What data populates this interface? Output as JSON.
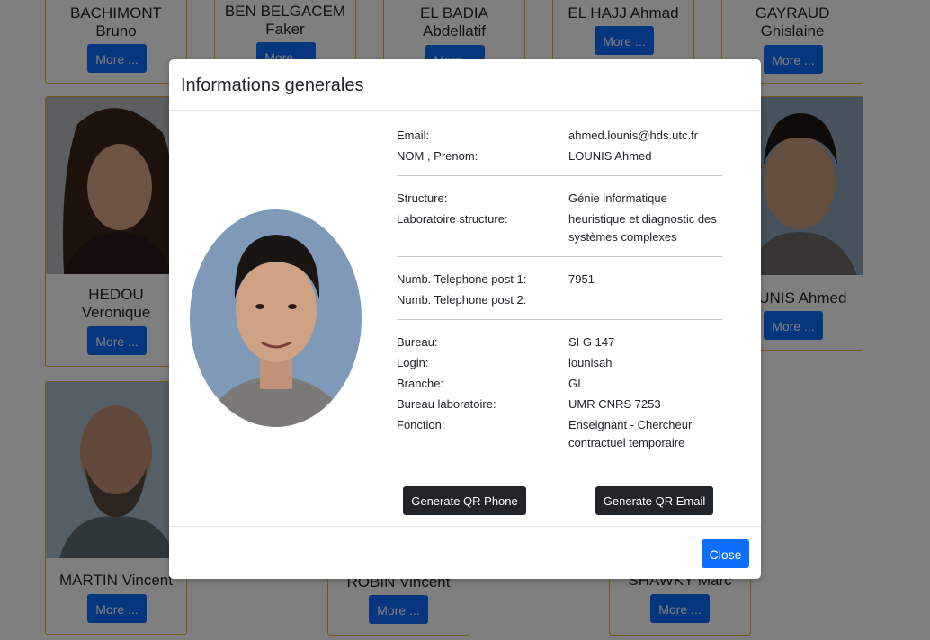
{
  "directory": {
    "cards": [
      {
        "name_line1": "BACHIMONT",
        "name_line2": "Bruno",
        "more_label": "More ..."
      },
      {
        "name_line1": "BEN BELGACEM",
        "name_line2": "Faker",
        "more_label": "More ..."
      },
      {
        "name_line1": "EL BADIA",
        "name_line2": "Abdellatif",
        "more_label": "More ..."
      },
      {
        "name_line1": "EL HAJJ Ahmad",
        "more_label": "More ..."
      },
      {
        "name_line1": "GAYRAUD",
        "name_line2": "Ghislaine",
        "more_label": "More ..."
      },
      {
        "name_line1": "HEDOU",
        "name_line2": "Veronique",
        "more_label": "More ..."
      },
      {
        "name_line1": "LOUNIS Ahmed",
        "more_label": "More ..."
      },
      {
        "name_line1": "MARTIN Vincent",
        "more_label": "More ..."
      },
      {
        "name_line1": "ROBIN Vincent",
        "more_label": "More ..."
      },
      {
        "name_line1": "SHAWKY Marc",
        "more_label": "More ..."
      }
    ]
  },
  "modal": {
    "title": "Informations generales",
    "fields": [
      {
        "label": "Email:",
        "value": "ahmed.lounis@hds.utc.fr"
      },
      {
        "label": "NOM , Prenom:",
        "value": "LOUNIS Ahmed"
      },
      {
        "label": "Structure:",
        "value": "Génie informatique"
      },
      {
        "label": "Laboratoire structure:",
        "value": "heuristique et diagnostic des systèmes complexes"
      },
      {
        "label": "Numb. Telephone post 1:",
        "value": "7951"
      },
      {
        "label": "Numb. Telephone post 2:",
        "value": ""
      },
      {
        "label": "Bureau:",
        "value": "SI G 147"
      },
      {
        "label": "Login:",
        "value": "lounisah"
      },
      {
        "label": "Branche:",
        "value": "GI"
      },
      {
        "label": "Bureau laboratoire:",
        "value": "UMR CNRS 7253"
      },
      {
        "label": "Fonction:",
        "value": "Enseignant - Chercheur contractuel temporaire"
      }
    ],
    "qr_phone_label": "Generate QR Phone",
    "qr_email_label": "Generate QR Email",
    "close_label": "Close"
  },
  "colors": {
    "primary": "#0d6efd",
    "dark_button": "#212529",
    "card_border": "#e3b62f",
    "backdrop": "rgba(0,0,0,0.5)"
  }
}
